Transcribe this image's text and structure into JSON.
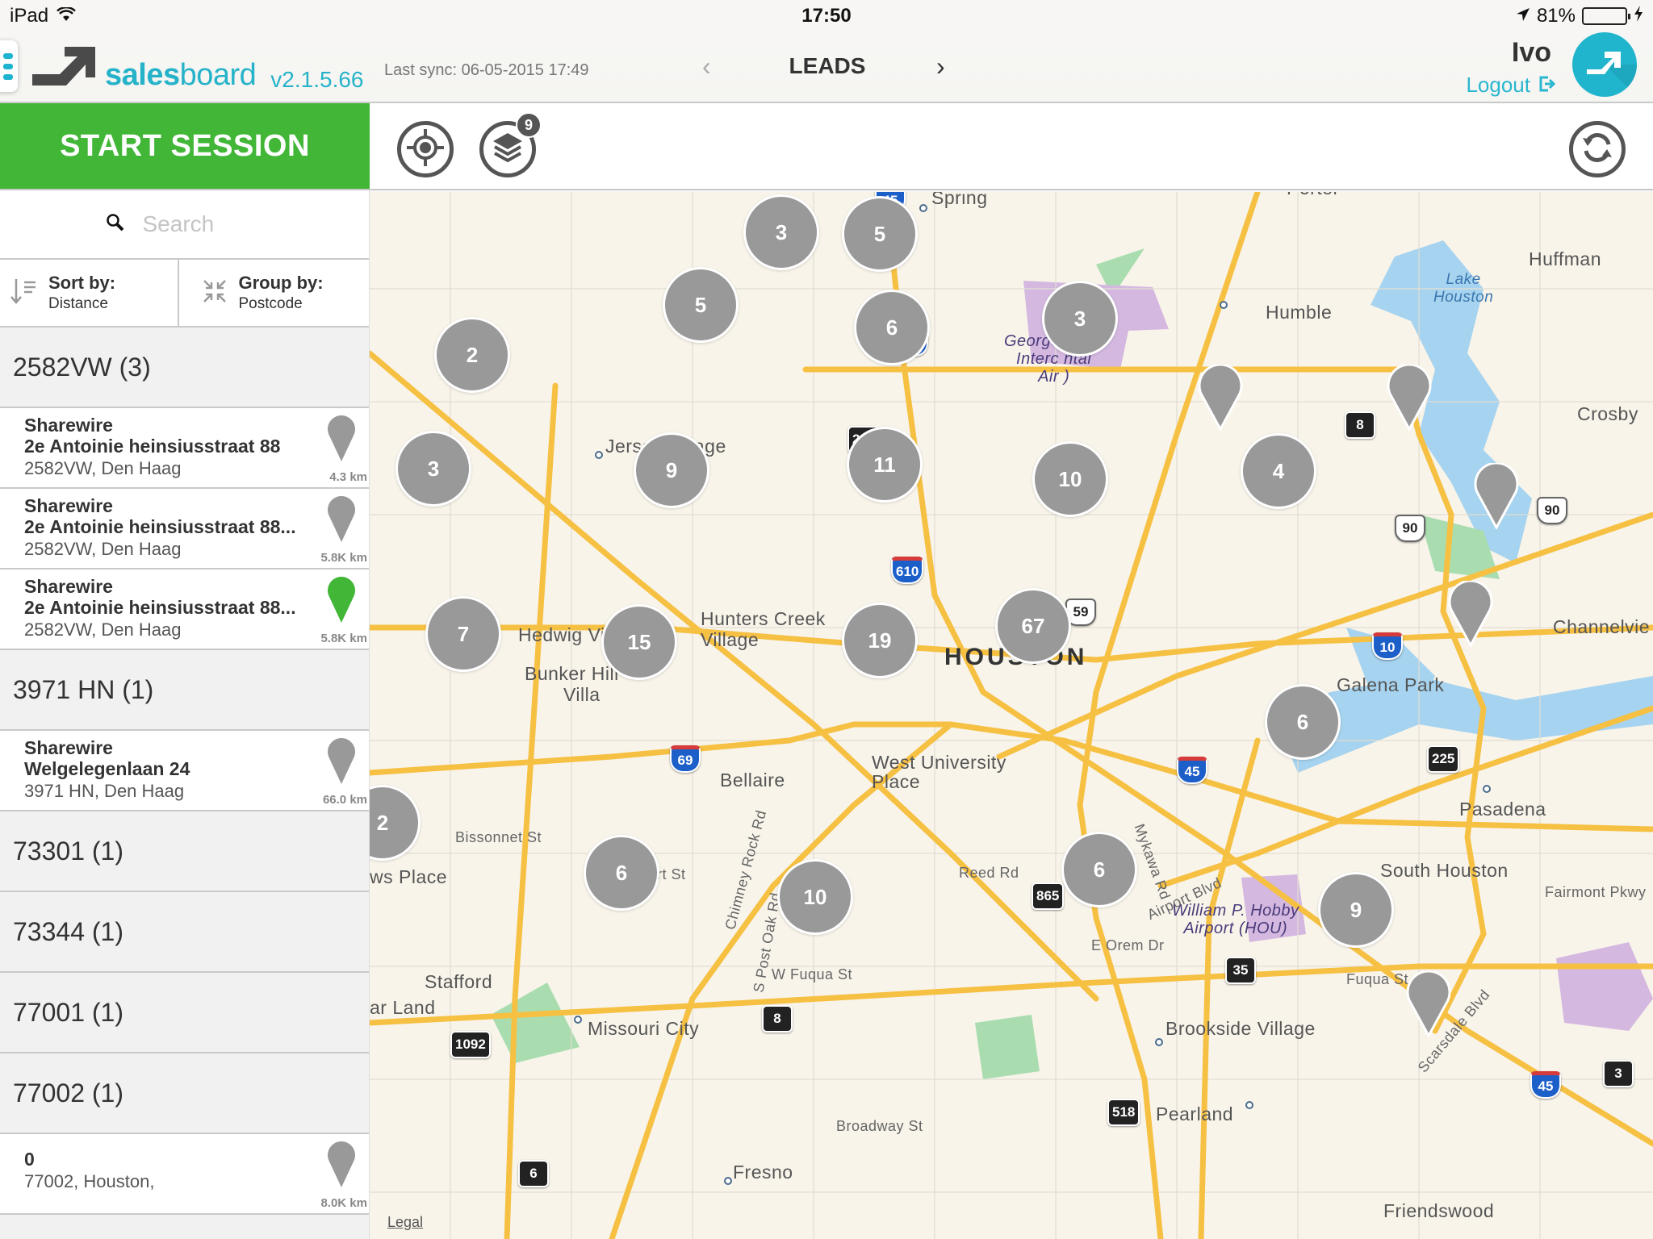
{
  "status_bar": {
    "device": "iPad",
    "time": "17:50",
    "battery_percent_label": "81%",
    "battery_level": 0.81
  },
  "header": {
    "logo_bold": "sales",
    "logo_light": "board",
    "version": "v2.1.5.66",
    "last_sync": "Last sync: 06-05-2015 17:49",
    "section_title": "LEADS",
    "prev_icon": "‹",
    "next_icon": "›",
    "user_name": "Ivo",
    "logout_label": "Logout"
  },
  "toolbar": {
    "start_session_label": "START SESSION",
    "layers_badge": "9"
  },
  "sidebar": {
    "search_placeholder": "Search",
    "sort_title": "Sort by:",
    "sort_value": "Distance",
    "group_title": "Group by:",
    "group_value": "Postcode",
    "groups": [
      {
        "label": "2582VW (3)",
        "leads": [
          {
            "company": "Sharewire",
            "street": "2e Antoinie heinsiusstraat 88",
            "city": "2582VW, Den Haag",
            "distance": "4.3 km",
            "pin_color": "#999999"
          },
          {
            "company": "Sharewire",
            "street": "2e Antoinie heinsiusstraat 88...",
            "city": "2582VW, Den Haag",
            "distance": "5.8K km",
            "pin_color": "#999999"
          },
          {
            "company": "Sharewire",
            "street": "2e Antoinie heinsiusstraat 88...",
            "city": "2582VW, Den Haag",
            "distance": "5.8K km",
            "pin_color": "#41b637"
          }
        ]
      },
      {
        "label": "3971 HN (1)",
        "leads": [
          {
            "company": "Sharewire",
            "street": "Welgelegenlaan 24",
            "city": "3971 HN, Den Haag",
            "distance": "66.0 km",
            "pin_color": "#999999"
          }
        ]
      },
      {
        "label": "73301 (1)",
        "leads": []
      },
      {
        "label": "73344 (1)",
        "leads": []
      },
      {
        "label": "77001 (1)",
        "leads": []
      },
      {
        "label": "77002 (1)",
        "leads": [
          {
            "company": "0",
            "street": "",
            "city": "77002, Houston,",
            "distance": "8.0K km",
            "pin_color": "#999999"
          }
        ]
      }
    ]
  },
  "map": {
    "legal_label": "Legal",
    "clusters": [
      "3",
      "5",
      "5",
      "2",
      "6",
      "3",
      "3",
      "9",
      "11",
      "10",
      "4",
      "7",
      "15",
      "19",
      "67",
      "6",
      "2",
      "6",
      "10",
      "6",
      "9"
    ],
    "places": {
      "spring": "Spring",
      "porter": "Porter",
      "humble": "Humble",
      "huffman": "Huffman",
      "crosby": "Crosby",
      "jersey_village": "Jersey Village",
      "hedwig_village": "Hedwig Village",
      "hunters_creek": "Hunters Creek",
      "hunters_creek2": "Village",
      "bunker_hill": "Bunker Hill",
      "bunker_hill2": "Villa",
      "houston": "HOUSTON",
      "galena_park": "Galena Park",
      "channelview": "Channelvie",
      "bellaire": "Bellaire",
      "west_university": "West University",
      "west_university2": "Place",
      "pasadena": "Pasadena",
      "south_houston": "South Houston",
      "stafford": "Stafford",
      "sugar_land": "ar Land",
      "missouri_city": "Missouri City",
      "brookside": "Brookside Village",
      "pearland": "Pearland",
      "fresno": "Fresno",
      "friendswood": "Friendswood",
      "meadows_place": "ws Place"
    },
    "airports": {
      "iah_line1": "George Bush",
      "iah_line2": "Interc        ntal",
      "iah_line3": "Air          )",
      "hou_line1": "William P. Hobby",
      "hou_line2": "Airport (HOU)"
    },
    "water": {
      "lake_line1": "Lake",
      "lake_line2": "Houston"
    },
    "streets": {
      "bissonnet": "Bissonnet St",
      "reed": "Reed Rd",
      "mykawa": "Mykawa Rd",
      "airport_blvd": "Airport Blvd",
      "orem": "E Orem Dr",
      "fuqua_w": "W Fuqua St",
      "fuqua": "Fuqua St",
      "fairmont": "Fairmont Pkwy",
      "broadway": "Broadway St",
      "chimney_rock": "Chimney Rock Rd",
      "post_oak": "S Post Oak Rd",
      "scarsdale": "Scarsdale Blvd",
      "ort": "rt St"
    },
    "shields": {
      "i45a": "45",
      "i45b": "45",
      "i45c": "45",
      "i45d": "45",
      "i610": "610",
      "i69": "69",
      "i10": "10",
      "tx249": "249",
      "tx8a": "8",
      "tx8b": "8",
      "us90a": "90",
      "us90b": "90",
      "us59": "59",
      "tx225": "225",
      "fm865": "865",
      "tx35": "35",
      "fm1092": "1092",
      "fm518": "518",
      "tx6": "6",
      "tx3": "3"
    }
  }
}
